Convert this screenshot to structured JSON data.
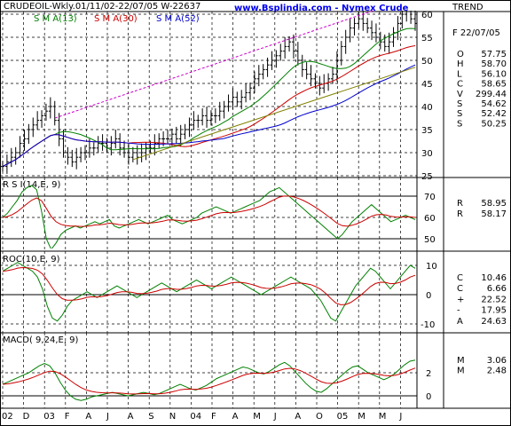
{
  "header": {
    "title": "www.Bsplindia.com - Nymex Crude",
    "trend_label": "TREND",
    "date": "F 22/07/05",
    "symbol_line": "CRUDEOIL-Wkly.01/11/02-22/07/05  W-22637",
    "sma13_label": "S M A(13)",
    "sma30_label": "S M A(30)",
    "sma52_label": "S M A(52)"
  },
  "colors": {
    "background": "#ffffff",
    "bars": "#000000",
    "sma13": "#008000",
    "sma30": "#cc0000",
    "sma52": "#0000cc",
    "trendline_upper": "#cc00cc",
    "trendline_lower": "#808000",
    "title": "#0000ee",
    "grid": "#000000"
  },
  "readouts": {
    "price": [
      {
        "key": "O",
        "value": "57.75",
        "color": "#000000"
      },
      {
        "key": "H",
        "value": "58.70",
        "color": "#000000"
      },
      {
        "key": "L",
        "value": "56.10",
        "color": "#000000"
      },
      {
        "key": "C",
        "value": "58.65",
        "color": "#000000"
      },
      {
        "key": "V",
        "value": "299.44",
        "color": "#0000cc"
      },
      {
        "key": "S",
        "value": "54.62",
        "color": "#008000"
      },
      {
        "key": "S",
        "value": "52.42",
        "color": "#cc0000"
      },
      {
        "key": "S",
        "value": "50.25",
        "color": "#0000cc"
      }
    ],
    "rsi": [
      {
        "key": "R",
        "value": "58.95",
        "color": "#008000"
      },
      {
        "key": "R",
        "value": "58.17",
        "color": "#cc0000"
      }
    ],
    "roc": [
      {
        "key": "C",
        "value": "10.46",
        "color": "#008000"
      },
      {
        "key": "C",
        "value": "6.66",
        "color": "#cc0000"
      },
      {
        "key": "+",
        "value": "22.52",
        "color": "#008000"
      },
      {
        "key": "-",
        "value": "17.95",
        "color": "#cc0000"
      },
      {
        "key": "A",
        "value": "24.63",
        "color": "#0000cc"
      }
    ],
    "macd": [
      {
        "key": "M",
        "value": "3.06",
        "color": "#008000"
      },
      {
        "key": "M",
        "value": "2.48",
        "color": "#cc0000"
      }
    ]
  },
  "chart_data": [
    {
      "type": "ohlc",
      "title": "www.Bsplindia.com - Nymex Crude",
      "subtitle": "CRUDEOIL-Wkly.01/11/02-22/07/05  W-22637",
      "x_tick_labels": [
        "02",
        "D",
        "03",
        "F",
        "A",
        "J",
        "A",
        "S",
        "N",
        "04",
        "F",
        "A",
        "M",
        "J",
        "A",
        "O",
        "05",
        "M",
        "M",
        "J"
      ],
      "y_ticks": [
        25,
        30,
        35,
        40,
        45,
        50,
        55,
        60
      ],
      "ylim": [
        25,
        63
      ],
      "grid": true,
      "close_approx": [
        27,
        28,
        29,
        30,
        32,
        33,
        35,
        36,
        37,
        38,
        39,
        40,
        37,
        33,
        30,
        29,
        28,
        29,
        30,
        30,
        31,
        31,
        32,
        32,
        31,
        32,
        33,
        31,
        30,
        29,
        30,
        29,
        30,
        31,
        31,
        32,
        33,
        33,
        33,
        34,
        33,
        34,
        35,
        36,
        37,
        37,
        38,
        37,
        38,
        38,
        39,
        40,
        41,
        42,
        41,
        42,
        43,
        44,
        46,
        47,
        48,
        49,
        50,
        51,
        52,
        53,
        54,
        52,
        50,
        48,
        47,
        46,
        45,
        44,
        45,
        46,
        47,
        50,
        53,
        55,
        57,
        58,
        59,
        58,
        57,
        56,
        55,
        54,
        53,
        54,
        56,
        58,
        60,
        61,
        59,
        58
      ],
      "series": [
        {
          "name": "S M A(13)"
        },
        {
          "name": "S M A(30)"
        },
        {
          "name": "S M A(52)"
        }
      ]
    },
    {
      "type": "line",
      "title": "R S I(14,E, 9)",
      "y_ticks": [
        50,
        60,
        70
      ],
      "ylim": [
        42,
        82
      ],
      "rsi_approx": [
        60,
        62,
        65,
        68,
        72,
        74,
        75,
        73,
        63,
        50,
        45,
        48,
        52,
        54,
        55,
        56,
        55,
        56,
        57,
        58,
        57,
        58,
        59,
        56,
        55,
        56,
        57,
        58,
        59,
        58,
        57,
        58,
        59,
        60,
        61,
        59,
        58,
        57,
        58,
        59,
        60,
        62,
        63,
        64,
        65,
        64,
        63,
        62,
        63,
        64,
        65,
        66,
        67,
        68,
        70,
        72,
        73,
        74,
        72,
        70,
        68,
        66,
        64,
        62,
        60,
        58,
        56,
        54,
        52,
        50,
        52,
        55,
        58,
        60,
        62,
        64,
        66,
        64,
        62,
        60,
        58,
        59,
        60,
        61,
        60,
        59
      ]
    },
    {
      "type": "line",
      "title": "ROC(10,E, 9)",
      "y_ticks": [
        -10,
        0,
        10
      ],
      "ylim": [
        -13,
        13
      ],
      "roc_approx": [
        8,
        9,
        10,
        11,
        10,
        9,
        8,
        6,
        2,
        -4,
        -8,
        -9,
        -7,
        -4,
        -2,
        -1,
        0,
        1,
        0,
        -1,
        0,
        1,
        2,
        3,
        2,
        1,
        0,
        -1,
        0,
        1,
        2,
        3,
        4,
        3,
        2,
        1,
        2,
        3,
        4,
        5,
        4,
        3,
        2,
        3,
        4,
        5,
        6,
        5,
        4,
        3,
        2,
        1,
        0,
        1,
        2,
        3,
        4,
        5,
        6,
        5,
        4,
        3,
        2,
        0,
        -2,
        -5,
        -8,
        -9,
        -6,
        -3,
        0,
        3,
        5,
        7,
        9,
        8,
        6,
        4,
        2,
        4,
        6,
        8,
        10,
        9
      ]
    },
    {
      "type": "line",
      "title": "MACD( 9,24,E, 9)",
      "y_ticks": [
        0,
        2
      ],
      "ylim": [
        -0.8,
        4
      ],
      "macd_approx": [
        1.0,
        1.2,
        1.4,
        1.6,
        1.8,
        2.0,
        2.3,
        2.6,
        2.8,
        2.6,
        2.0,
        1.2,
        0.5,
        0.0,
        -0.3,
        -0.4,
        -0.3,
        -0.1,
        0.0,
        0.1,
        0.2,
        0.3,
        0.2,
        0.1,
        0.0,
        0.1,
        0.2,
        0.3,
        0.2,
        0.1,
        0.2,
        0.4,
        0.6,
        0.8,
        1.0,
        0.8,
        0.6,
        0.5,
        0.7,
        0.9,
        1.2,
        1.5,
        1.7,
        1.9,
        2.1,
        2.3,
        2.5,
        2.4,
        2.2,
        2.0,
        1.9,
        2.1,
        2.4,
        2.7,
        2.9,
        2.6,
        2.1,
        1.6,
        1.1,
        0.7,
        0.4,
        0.3,
        0.6,
        1.0,
        1.4,
        1.8,
        2.2,
        2.5,
        2.6,
        2.3,
        2.0,
        1.8,
        1.6,
        1.4,
        1.6,
        1.9,
        2.3,
        2.7,
        3.0,
        3.1
      ]
    }
  ]
}
